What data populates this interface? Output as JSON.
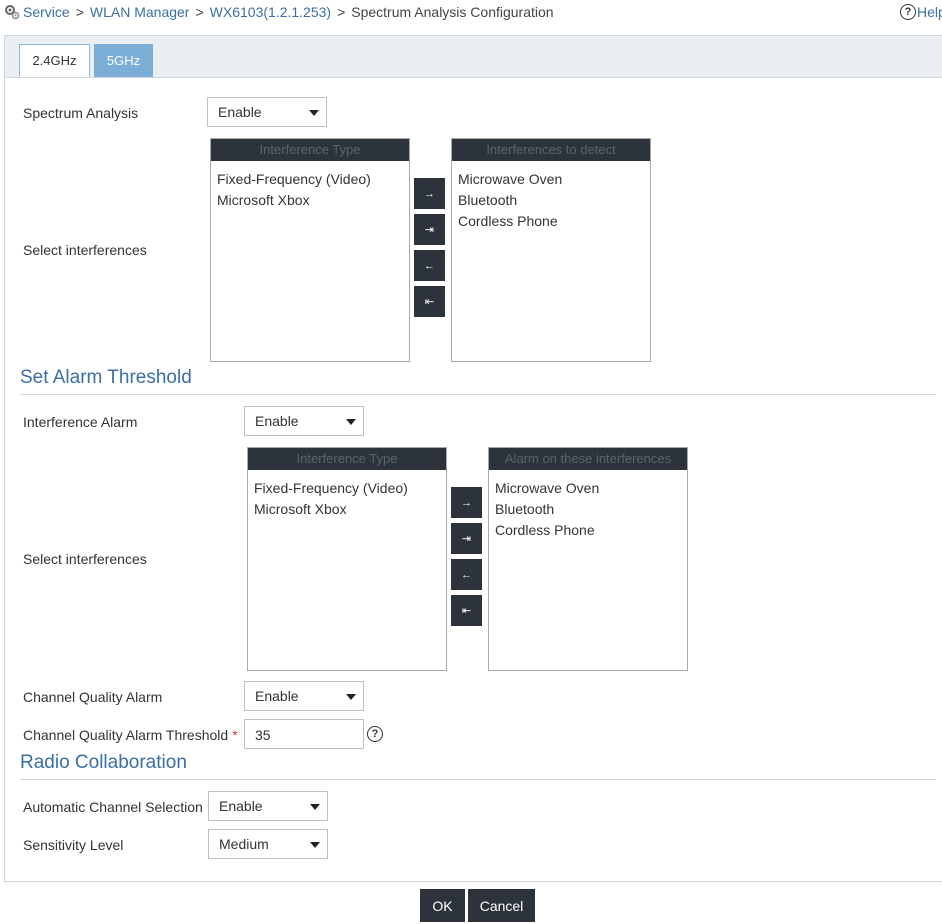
{
  "breadcrumb": {
    "items": [
      "Service",
      "WLAN Manager",
      "WX6103(1.2.1.253)",
      "Spectrum Analysis Configuration"
    ],
    "separator": ">"
  },
  "help": {
    "label": "Help"
  },
  "tabs": [
    {
      "label": "2.4GHz",
      "active": true
    },
    {
      "label": "5GHz",
      "active": false
    }
  ],
  "spectrum": {
    "label": "Spectrum Analysis",
    "value": "Enable",
    "select_label": "Select interferences",
    "available_header": "Interference Type",
    "available": [
      "Fixed-Frequency (Video)",
      "Microsoft Xbox"
    ],
    "selected_header": "Interferences to detect",
    "selected": [
      "Microwave Oven",
      "Bluetooth",
      "Cordless Phone"
    ]
  },
  "alarm": {
    "section_title": "Set Alarm Threshold",
    "interference_label": "Interference Alarm",
    "interference_value": "Enable",
    "select_label": "Select interferences",
    "available_header": "Interference Type",
    "available": [
      "Fixed-Frequency (Video)",
      "Microsoft Xbox"
    ],
    "selected_header": "Alarm on these interferences",
    "selected": [
      "Microwave Oven",
      "Bluetooth",
      "Cordless Phone"
    ],
    "cq_label": "Channel Quality Alarm",
    "cq_value": "Enable",
    "cq_threshold_label": "Channel Quality Alarm Threshold",
    "required_mark": "*",
    "cq_threshold_value": "35"
  },
  "radio": {
    "section_title": "Radio Collaboration",
    "acs_label": "Automatic Channel Selection",
    "acs_value": "Enable",
    "sensitivity_label": "Sensitivity Level",
    "sensitivity_value": "Medium"
  },
  "move_buttons": [
    "→",
    "⇥",
    "←",
    "⇤"
  ],
  "buttons": {
    "ok": "OK",
    "cancel": "Cancel"
  },
  "colors": {
    "accent": "#3a6ea5",
    "dark": "#2d333b",
    "tab_inactive": "#7aaed6"
  }
}
